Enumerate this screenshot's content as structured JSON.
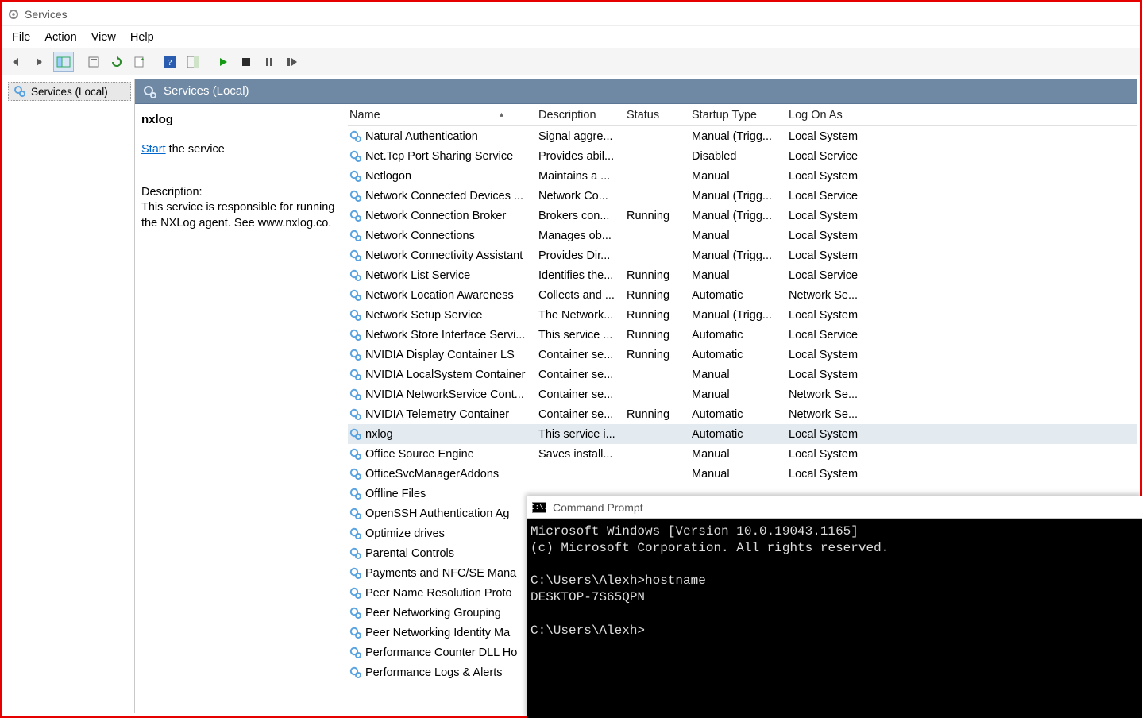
{
  "window": {
    "title": "Services"
  },
  "menus": {
    "file": "File",
    "action": "Action",
    "view": "View",
    "help": "Help"
  },
  "tree": {
    "root": "Services (Local)"
  },
  "list_header": "Services (Local)",
  "detail": {
    "selected_name": "nxlog",
    "start_link": "Start",
    "start_rest": " the service",
    "desc_label": "Description:",
    "description": "This service is responsible for running the NXLog agent. See www.nxlog.co."
  },
  "columns": {
    "name": "Name",
    "description": "Description",
    "status": "Status",
    "startup": "Startup Type",
    "logon": "Log On As"
  },
  "services": [
    {
      "name": "Natural Authentication",
      "description": "Signal aggre...",
      "status": "",
      "startup": "Manual (Trigg...",
      "logon": "Local System"
    },
    {
      "name": "Net.Tcp Port Sharing Service",
      "description": "Provides abil...",
      "status": "",
      "startup": "Disabled",
      "logon": "Local Service"
    },
    {
      "name": "Netlogon",
      "description": "Maintains a ...",
      "status": "",
      "startup": "Manual",
      "logon": "Local System"
    },
    {
      "name": "Network Connected Devices ...",
      "description": "Network Co...",
      "status": "",
      "startup": "Manual (Trigg...",
      "logon": "Local Service"
    },
    {
      "name": "Network Connection Broker",
      "description": "Brokers con...",
      "status": "Running",
      "startup": "Manual (Trigg...",
      "logon": "Local System"
    },
    {
      "name": "Network Connections",
      "description": "Manages ob...",
      "status": "",
      "startup": "Manual",
      "logon": "Local System"
    },
    {
      "name": "Network Connectivity Assistant",
      "description": "Provides Dir...",
      "status": "",
      "startup": "Manual (Trigg...",
      "logon": "Local System"
    },
    {
      "name": "Network List Service",
      "description": "Identifies the...",
      "status": "Running",
      "startup": "Manual",
      "logon": "Local Service"
    },
    {
      "name": "Network Location Awareness",
      "description": "Collects and ...",
      "status": "Running",
      "startup": "Automatic",
      "logon": "Network Se..."
    },
    {
      "name": "Network Setup Service",
      "description": "The Network...",
      "status": "Running",
      "startup": "Manual (Trigg...",
      "logon": "Local System"
    },
    {
      "name": "Network Store Interface Servi...",
      "description": "This service ...",
      "status": "Running",
      "startup": "Automatic",
      "logon": "Local Service"
    },
    {
      "name": "NVIDIA Display Container LS",
      "description": "Container se...",
      "status": "Running",
      "startup": "Automatic",
      "logon": "Local System"
    },
    {
      "name": "NVIDIA LocalSystem Container",
      "description": "Container se...",
      "status": "",
      "startup": "Manual",
      "logon": "Local System"
    },
    {
      "name": "NVIDIA NetworkService Cont...",
      "description": "Container se...",
      "status": "",
      "startup": "Manual",
      "logon": "Network Se..."
    },
    {
      "name": "NVIDIA Telemetry Container",
      "description": "Container se...",
      "status": "Running",
      "startup": "Automatic",
      "logon": "Network Se..."
    },
    {
      "name": "nxlog",
      "description": "This service i...",
      "status": "",
      "startup": "Automatic",
      "logon": "Local System",
      "selected": true
    },
    {
      "name": "Office  Source Engine",
      "description": "Saves install...",
      "status": "",
      "startup": "Manual",
      "logon": "Local System"
    },
    {
      "name": "OfficeSvcManagerAddons",
      "description": "",
      "status": "",
      "startup": "Manual",
      "logon": "Local System"
    },
    {
      "name": "Offline Files",
      "description": "",
      "status": "",
      "startup": "",
      "logon": ""
    },
    {
      "name": "OpenSSH Authentication Ag",
      "description": "",
      "status": "",
      "startup": "",
      "logon": ""
    },
    {
      "name": "Optimize drives",
      "description": "",
      "status": "",
      "startup": "",
      "logon": ""
    },
    {
      "name": "Parental Controls",
      "description": "",
      "status": "",
      "startup": "",
      "logon": ""
    },
    {
      "name": "Payments and NFC/SE Mana",
      "description": "",
      "status": "",
      "startup": "",
      "logon": ""
    },
    {
      "name": "Peer Name Resolution Proto",
      "description": "",
      "status": "",
      "startup": "",
      "logon": ""
    },
    {
      "name": "Peer Networking Grouping",
      "description": "",
      "status": "",
      "startup": "",
      "logon": ""
    },
    {
      "name": "Peer Networking Identity Ma",
      "description": "",
      "status": "",
      "startup": "",
      "logon": ""
    },
    {
      "name": "Performance Counter DLL Ho",
      "description": "",
      "status": "",
      "startup": "",
      "logon": ""
    },
    {
      "name": "Performance Logs & Alerts",
      "description": "",
      "status": "",
      "startup": "",
      "logon": ""
    }
  ],
  "cmd": {
    "title": "Command Prompt",
    "lines": [
      "Microsoft Windows [Version 10.0.19043.1165]",
      "(c) Microsoft Corporation. All rights reserved.",
      "",
      "C:\\Users\\Alexh>hostname",
      "DESKTOP-7S65QPN",
      "",
      "C:\\Users\\Alexh>"
    ],
    "icon_text": "C:\\."
  }
}
